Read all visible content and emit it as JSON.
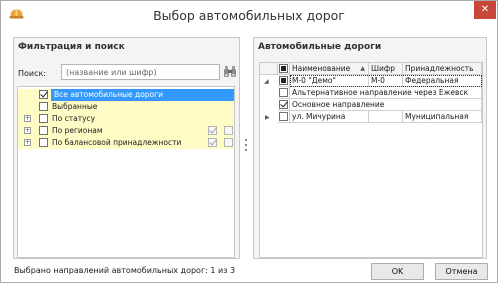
{
  "window": {
    "title": "Выбор автомобильных дорог",
    "close_glyph": "✕",
    "app_icon": "road-helmet-icon"
  },
  "filter_panel": {
    "title": "Фильтрация и поиск",
    "search": {
      "label": "Поиск:",
      "placeholder": "(название или шифр)",
      "value": "",
      "icon": "binoculars-icon"
    },
    "items": [
      {
        "label": "Все автомобильные дороги",
        "checked": true,
        "selected": true,
        "expandable": false
      },
      {
        "label": "Выбранные",
        "checked": false,
        "selected": false,
        "expandable": false
      },
      {
        "label": "По статусу",
        "checked": false,
        "selected": false,
        "expandable": true
      },
      {
        "label": "По регионам",
        "checked": false,
        "selected": false,
        "expandable": true
      },
      {
        "label": "По балансовой принадлежности",
        "checked": false,
        "selected": false,
        "expandable": true
      }
    ]
  },
  "roads_panel": {
    "title": "Автомобильные дороги",
    "columns": {
      "name": "Наименование",
      "sort_glyph": "▲",
      "code": "Шифр",
      "owner": "Принадлежность"
    },
    "rows": [
      {
        "name": "М-0 \"Демо\"",
        "code": "М-0",
        "owner": "Федеральная",
        "expanded": true
      },
      {
        "name": "Альтернативное направление через Ежевск",
        "checked": false
      },
      {
        "name": "Основное направление",
        "checked": true
      },
      {
        "name": "ул. Мичурина",
        "code": "",
        "owner": "Муниципальная",
        "expanded": false
      }
    ]
  },
  "footer": {
    "status": "Выбрано направлений автомобильных дорог: 1 из 3",
    "ok_label": "OK",
    "cancel_label": "Отмена"
  },
  "colors": {
    "selection": "#3399ff",
    "filter_highlight": "#fffcc6",
    "close_button": "#c7483b"
  }
}
